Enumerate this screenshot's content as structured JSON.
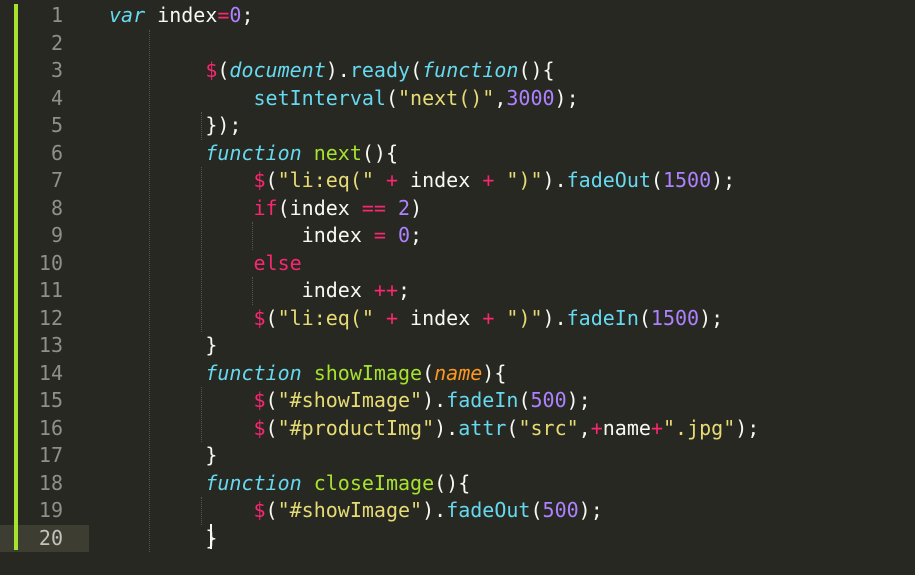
{
  "editor": {
    "theme_colors": {
      "background": "#272822",
      "keyword": "#f92672",
      "storage": "#66d9ef",
      "function_name": "#a6e22e",
      "number": "#ae81ff",
      "string": "#e6db74",
      "parameter": "#fd971f",
      "text": "#f8f8f2",
      "modified_marker": "#a6e22e"
    },
    "active_line": 20,
    "line_numbers": [
      "1",
      "2",
      "3",
      "4",
      "5",
      "6",
      "7",
      "8",
      "9",
      "10",
      "11",
      "12",
      "13",
      "14",
      "15",
      "16",
      "17",
      "18",
      "19",
      "20"
    ],
    "lines": [
      [
        [
          "st",
          "var"
        ],
        [
          "plain",
          " index"
        ],
        [
          "kw",
          "="
        ],
        [
          "num-c",
          "0"
        ],
        [
          "plain",
          ";"
        ]
      ],
      [],
      [
        [
          "plain",
          "        "
        ],
        [
          "kw",
          "$"
        ],
        [
          "plain",
          "("
        ],
        [
          "st",
          "document"
        ],
        [
          "plain",
          ")."
        ],
        [
          "sp",
          "ready"
        ],
        [
          "plain",
          "("
        ],
        [
          "st",
          "function"
        ],
        [
          "plain",
          "(){"
        ]
      ],
      [
        [
          "plain",
          "            "
        ],
        [
          "sp",
          "setInterval"
        ],
        [
          "plain",
          "("
        ],
        [
          "str",
          "\"next()\""
        ],
        [
          "plain",
          ","
        ],
        [
          "num-c",
          "3000"
        ],
        [
          "plain",
          ");"
        ]
      ],
      [
        [
          "plain",
          "        });"
        ]
      ],
      [
        [
          "plain",
          "        "
        ],
        [
          "st",
          "function"
        ],
        [
          "plain",
          " "
        ],
        [
          "fn",
          "next"
        ],
        [
          "plain",
          "(){"
        ]
      ],
      [
        [
          "plain",
          "            "
        ],
        [
          "kw",
          "$"
        ],
        [
          "plain",
          "("
        ],
        [
          "str",
          "\"li:eq(\""
        ],
        [
          "plain",
          " "
        ],
        [
          "kw",
          "+"
        ],
        [
          "plain",
          " index "
        ],
        [
          "kw",
          "+"
        ],
        [
          "plain",
          " "
        ],
        [
          "str",
          "\")\""
        ],
        [
          "plain",
          ")."
        ],
        [
          "sp",
          "fadeOut"
        ],
        [
          "plain",
          "("
        ],
        [
          "num-c",
          "1500"
        ],
        [
          "plain",
          ");"
        ]
      ],
      [
        [
          "plain",
          "            "
        ],
        [
          "kw",
          "if"
        ],
        [
          "plain",
          "(index "
        ],
        [
          "kw",
          "=="
        ],
        [
          "plain",
          " "
        ],
        [
          "num-c",
          "2"
        ],
        [
          "plain",
          ")"
        ]
      ],
      [
        [
          "plain",
          "                index "
        ],
        [
          "kw",
          "="
        ],
        [
          "plain",
          " "
        ],
        [
          "num-c",
          "0"
        ],
        [
          "plain",
          ";"
        ]
      ],
      [
        [
          "plain",
          "            "
        ],
        [
          "kw",
          "else"
        ]
      ],
      [
        [
          "plain",
          "                index "
        ],
        [
          "kw",
          "++"
        ],
        [
          "plain",
          ";"
        ]
      ],
      [
        [
          "plain",
          "            "
        ],
        [
          "kw",
          "$"
        ],
        [
          "plain",
          "("
        ],
        [
          "str",
          "\"li:eq(\""
        ],
        [
          "plain",
          " "
        ],
        [
          "kw",
          "+"
        ],
        [
          "plain",
          " index "
        ],
        [
          "kw",
          "+"
        ],
        [
          "plain",
          " "
        ],
        [
          "str",
          "\")\""
        ],
        [
          "plain",
          ")."
        ],
        [
          "sp",
          "fadeIn"
        ],
        [
          "plain",
          "("
        ],
        [
          "num-c",
          "1500"
        ],
        [
          "plain",
          ");"
        ]
      ],
      [
        [
          "plain",
          "        }"
        ]
      ],
      [
        [
          "plain",
          "        "
        ],
        [
          "st",
          "function"
        ],
        [
          "plain",
          " "
        ],
        [
          "fn",
          "showImage"
        ],
        [
          "plain",
          "("
        ],
        [
          "param",
          "name"
        ],
        [
          "plain",
          "){"
        ]
      ],
      [
        [
          "plain",
          "            "
        ],
        [
          "kw",
          "$"
        ],
        [
          "plain",
          "("
        ],
        [
          "str",
          "\"#showImage\""
        ],
        [
          "plain",
          ")."
        ],
        [
          "sp",
          "fadeIn"
        ],
        [
          "plain",
          "("
        ],
        [
          "num-c",
          "500"
        ],
        [
          "plain",
          ");"
        ]
      ],
      [
        [
          "plain",
          "            "
        ],
        [
          "kw",
          "$"
        ],
        [
          "plain",
          "("
        ],
        [
          "str",
          "\"#productImg\""
        ],
        [
          "plain",
          ")."
        ],
        [
          "sp",
          "attr"
        ],
        [
          "plain",
          "("
        ],
        [
          "str",
          "\"src\""
        ],
        [
          "plain",
          ","
        ],
        [
          "kw",
          "+"
        ],
        [
          "plain",
          "name"
        ],
        [
          "kw",
          "+"
        ],
        [
          "str",
          "\".jpg\""
        ],
        [
          "plain",
          ");"
        ]
      ],
      [
        [
          "plain",
          "        }"
        ]
      ],
      [
        [
          "plain",
          "        "
        ],
        [
          "st",
          "function"
        ],
        [
          "plain",
          " "
        ],
        [
          "fn",
          "closeImage"
        ],
        [
          "plain",
          "(){"
        ]
      ],
      [
        [
          "plain",
          "            "
        ],
        [
          "kw",
          "$"
        ],
        [
          "plain",
          "("
        ],
        [
          "str",
          "\"#showImage\""
        ],
        [
          "plain",
          ")."
        ],
        [
          "sp",
          "fadeOut"
        ],
        [
          "plain",
          "("
        ],
        [
          "num-c",
          "500"
        ],
        [
          "plain",
          ");"
        ]
      ],
      [
        [
          "plain",
          "        }"
        ]
      ]
    ]
  }
}
